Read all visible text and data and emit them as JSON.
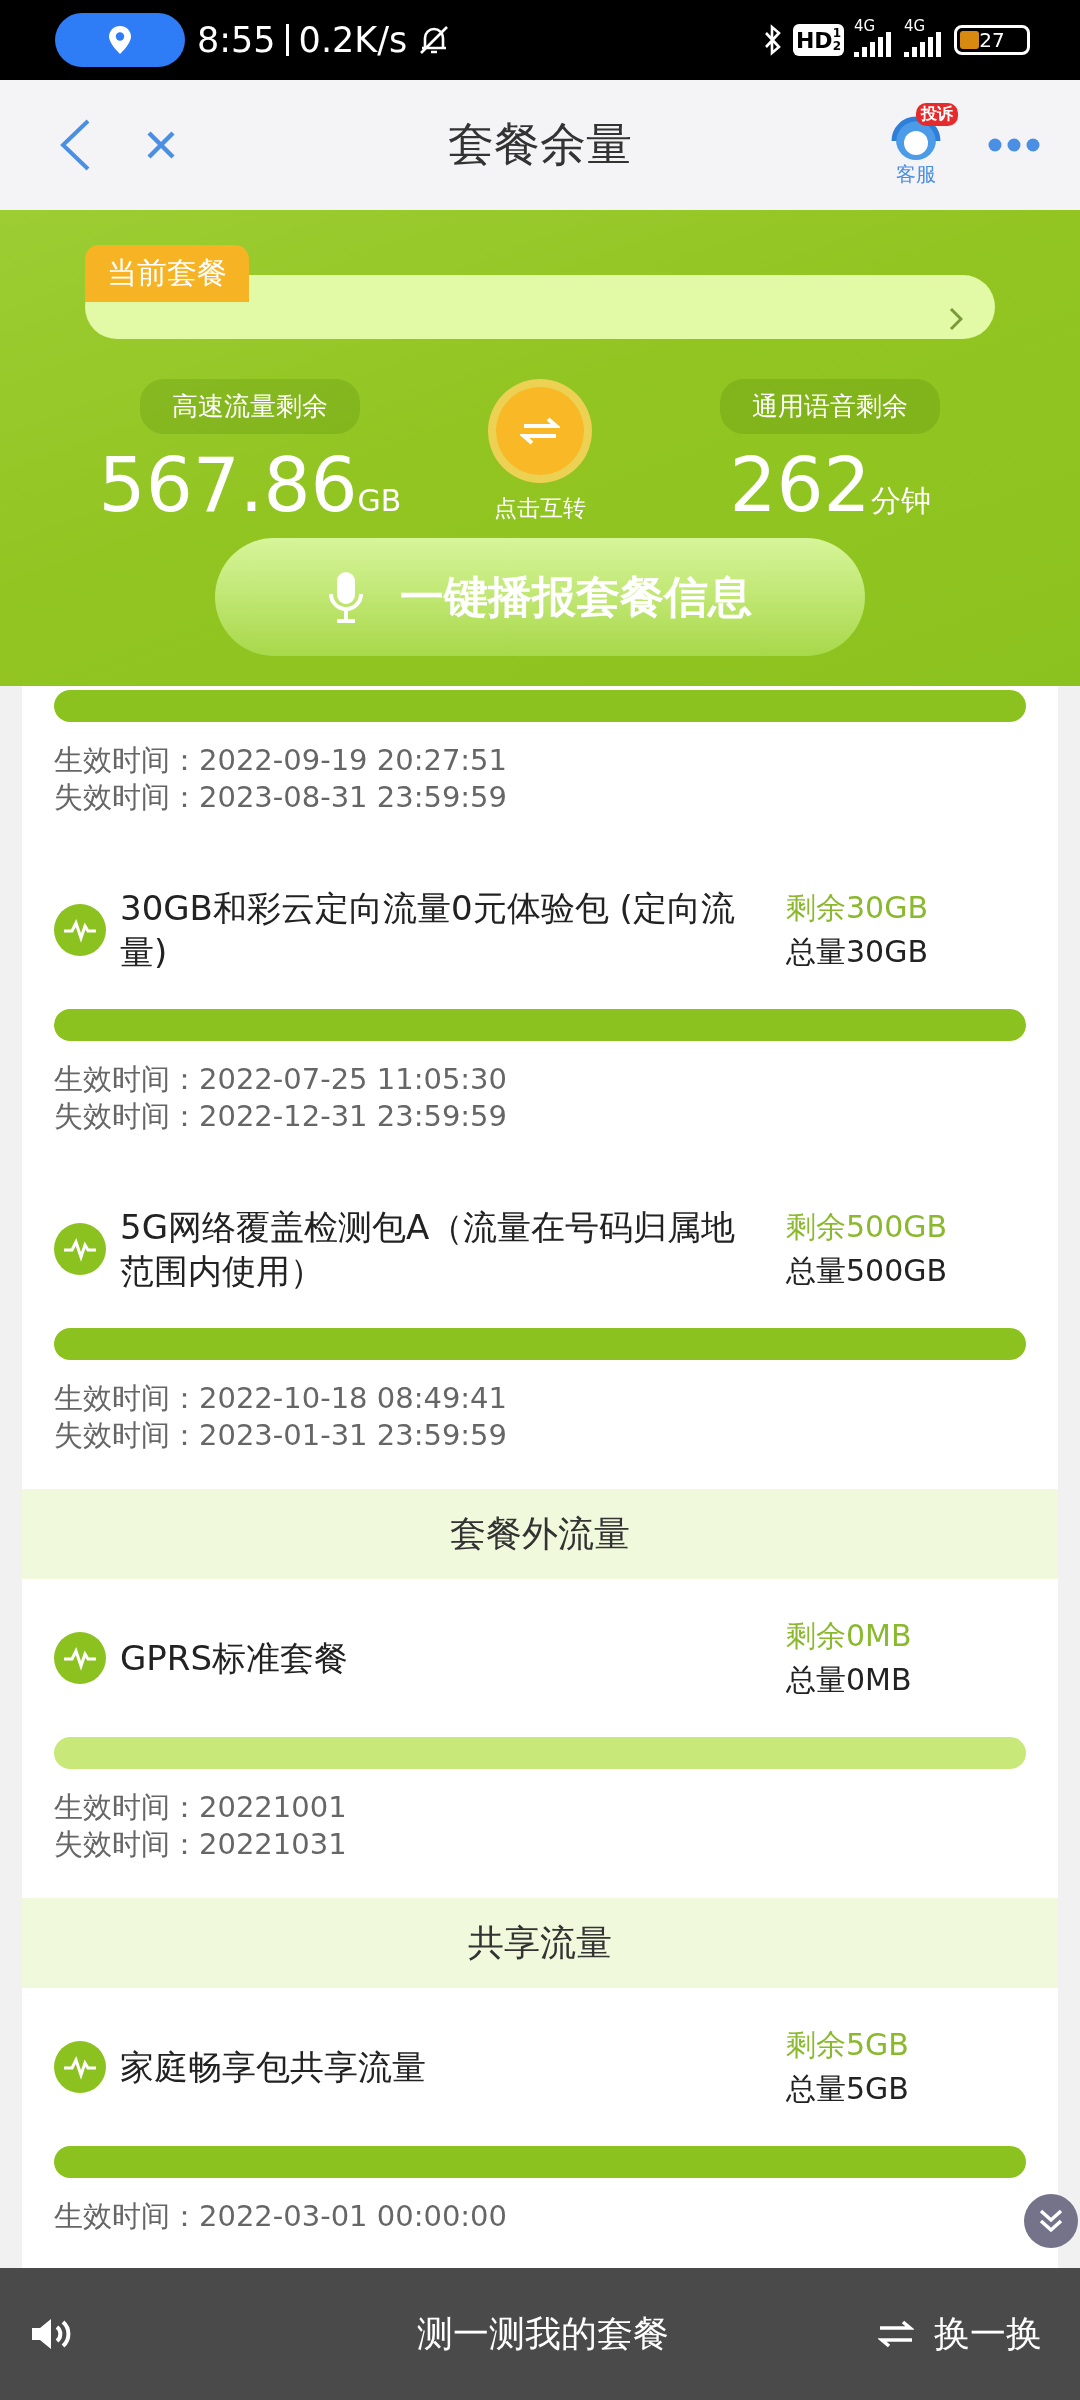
{
  "status_bar": {
    "time": "8:55",
    "net_speed": "0.2K/s",
    "hd_badge": "HD",
    "hd_fraction": [
      "1",
      "2"
    ],
    "signals": [
      {
        "label": "4G"
      },
      {
        "label": "4G"
      }
    ],
    "battery": "27"
  },
  "header": {
    "title": "套餐余量",
    "service_badge": "投诉",
    "service_label": "客服"
  },
  "banner": {
    "plan_tag": "当前套餐",
    "data_label": "高速流量剩余",
    "data_value": "567.86",
    "data_unit": "GB",
    "swap_label": "点击互转",
    "voice_label": "通用语音剩余",
    "voice_value": "262",
    "voice_unit": "分钟",
    "broadcast_button": "一键播报套餐信息"
  },
  "sections": [
    {
      "items": [
        {
          "level": 1,
          "dates": [
            "生效时间：2022-09-19 20:27:51",
            "失效时间：2023-08-31 23:59:59"
          ]
        },
        {
          "title": "30GB和彩云定向流量0元体验包 (定向流量)",
          "remaining": "剩余30GB",
          "total": "总量30GB",
          "level": 1,
          "dates": [
            "生效时间：2022-07-25 11:05:30",
            "失效时间：2022-12-31 23:59:59"
          ]
        },
        {
          "title": "5G网络覆盖检测包A（流量在号码归属地范围内使用）",
          "remaining": "剩余500GB",
          "total": "总量500GB",
          "level": 1,
          "dates": [
            "生效时间：2022-10-18 08:49:41",
            "失效时间：2023-01-31 23:59:59"
          ]
        }
      ]
    },
    {
      "header": "套餐外流量",
      "items": [
        {
          "title": "GPRS标准套餐",
          "remaining": "剩余0MB",
          "total": "总量0MB",
          "level": 0,
          "dates": [
            "生效时间：20221001",
            "失效时间：20221031"
          ]
        }
      ]
    },
    {
      "header": "共享流量",
      "items": [
        {
          "title": "家庭畅享包共享流量",
          "remaining": "剩余5GB",
          "total": "总量5GB",
          "level": 1,
          "dates": [
            "生效时间：2022-03-01 00:00:00"
          ]
        }
      ]
    }
  ],
  "bottom_bar": {
    "center": "测一测我的套餐",
    "right": "换一换"
  }
}
